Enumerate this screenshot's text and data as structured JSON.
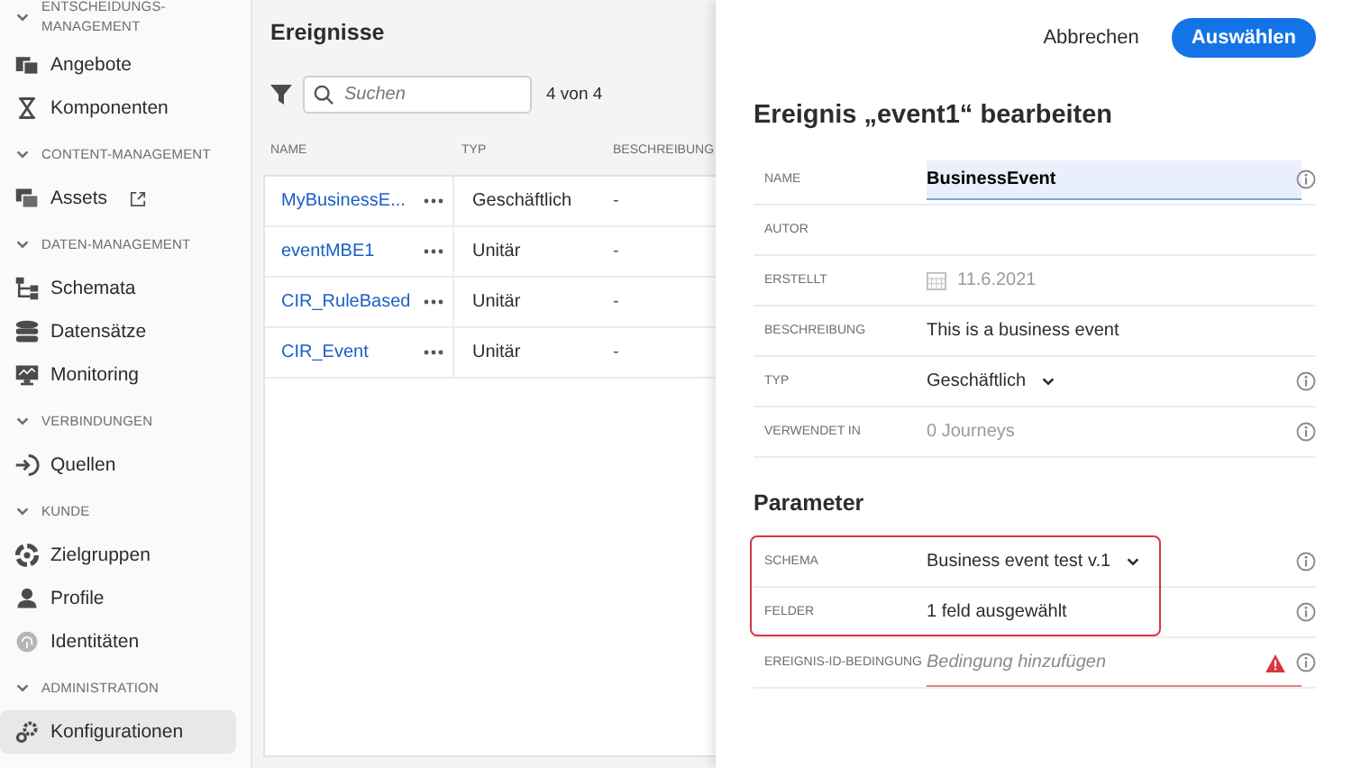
{
  "sidebar": {
    "sections": [
      {
        "title": "ENTSCHEIDUNGS-MANAGEMENT",
        "expanded": true,
        "items": [
          {
            "label": "Angebote",
            "selected": false,
            "external": false
          },
          {
            "label": "Komponenten",
            "selected": false,
            "external": false
          }
        ]
      },
      {
        "title": "CONTENT-MANAGEMENT",
        "expanded": true,
        "items": [
          {
            "label": "Assets",
            "selected": false,
            "external": true
          }
        ]
      },
      {
        "title": "DATEN-MANAGEMENT",
        "expanded": true,
        "items": [
          {
            "label": "Schemata",
            "selected": false,
            "external": false
          },
          {
            "label": "Datensätze",
            "selected": false,
            "external": false
          },
          {
            "label": "Monitoring",
            "selected": false,
            "external": false
          }
        ]
      },
      {
        "title": "VERBINDUNGEN",
        "expanded": true,
        "items": [
          {
            "label": "Quellen",
            "selected": false,
            "external": false
          }
        ]
      },
      {
        "title": "KUNDE",
        "expanded": true,
        "items": [
          {
            "label": "Zielgruppen",
            "selected": false,
            "external": false
          },
          {
            "label": "Profile",
            "selected": false,
            "external": false
          },
          {
            "label": "Identitäten",
            "selected": false,
            "external": false
          }
        ]
      },
      {
        "title": "ADMINISTRATION",
        "expanded": true,
        "items": [
          {
            "label": "Konfigurationen",
            "selected": true,
            "external": false
          }
        ]
      }
    ]
  },
  "events": {
    "title": "Ereignisse",
    "search": {
      "placeholder": "Suchen"
    },
    "count": "4 von 4",
    "columns": [
      "NAME",
      "TYP",
      "BESCHREIBUNG"
    ],
    "rows": [
      {
        "name": "MyBusinessE...",
        "type": "Geschäftlich",
        "description": "-"
      },
      {
        "name": "eventMBE1",
        "type": "Unitär",
        "description": "-"
      },
      {
        "name": "CIR_RuleBased",
        "type": "Unitär",
        "description": "-"
      },
      {
        "name": "CIR_Event",
        "type": "Unitär",
        "description": "-"
      }
    ]
  },
  "edit": {
    "cancel": "Abbrechen",
    "confirm": "Auswählen",
    "title": "Ereignis „event1“ bearbeiten",
    "fields": [
      {
        "label": "NAME",
        "kind": "input",
        "value": "BusinessEvent",
        "info": true
      },
      {
        "label": "AUTOR",
        "kind": "empty",
        "info": false
      },
      {
        "label": "ERSTELLT",
        "kind": "date",
        "value": "11.6.2021",
        "info": false
      },
      {
        "label": "BESCHREIBUNG",
        "kind": "text",
        "value": "This is a business event",
        "info": false
      },
      {
        "label": "TYP",
        "kind": "dropdown",
        "value": "Geschäftlich",
        "info": true
      },
      {
        "label": "VERWENDET IN",
        "kind": "muted",
        "value": "0 Journeys",
        "info": true
      }
    ],
    "parameters_title": "Parameter",
    "parameters": [
      {
        "label": "SCHEMA",
        "kind": "dropdown",
        "value": "Business event test v.1",
        "info": true,
        "highlighted": true,
        "error": false
      },
      {
        "label": "FELDER",
        "kind": "text",
        "value": "1 feld ausgewählt",
        "info": true,
        "highlighted": true,
        "error": false
      },
      {
        "label": "EREIGNIS-ID-BEDINGUNG",
        "kind": "input",
        "placeholder": "Bedingung hinzufügen",
        "info": true,
        "highlighted": false,
        "error": true
      }
    ]
  }
}
